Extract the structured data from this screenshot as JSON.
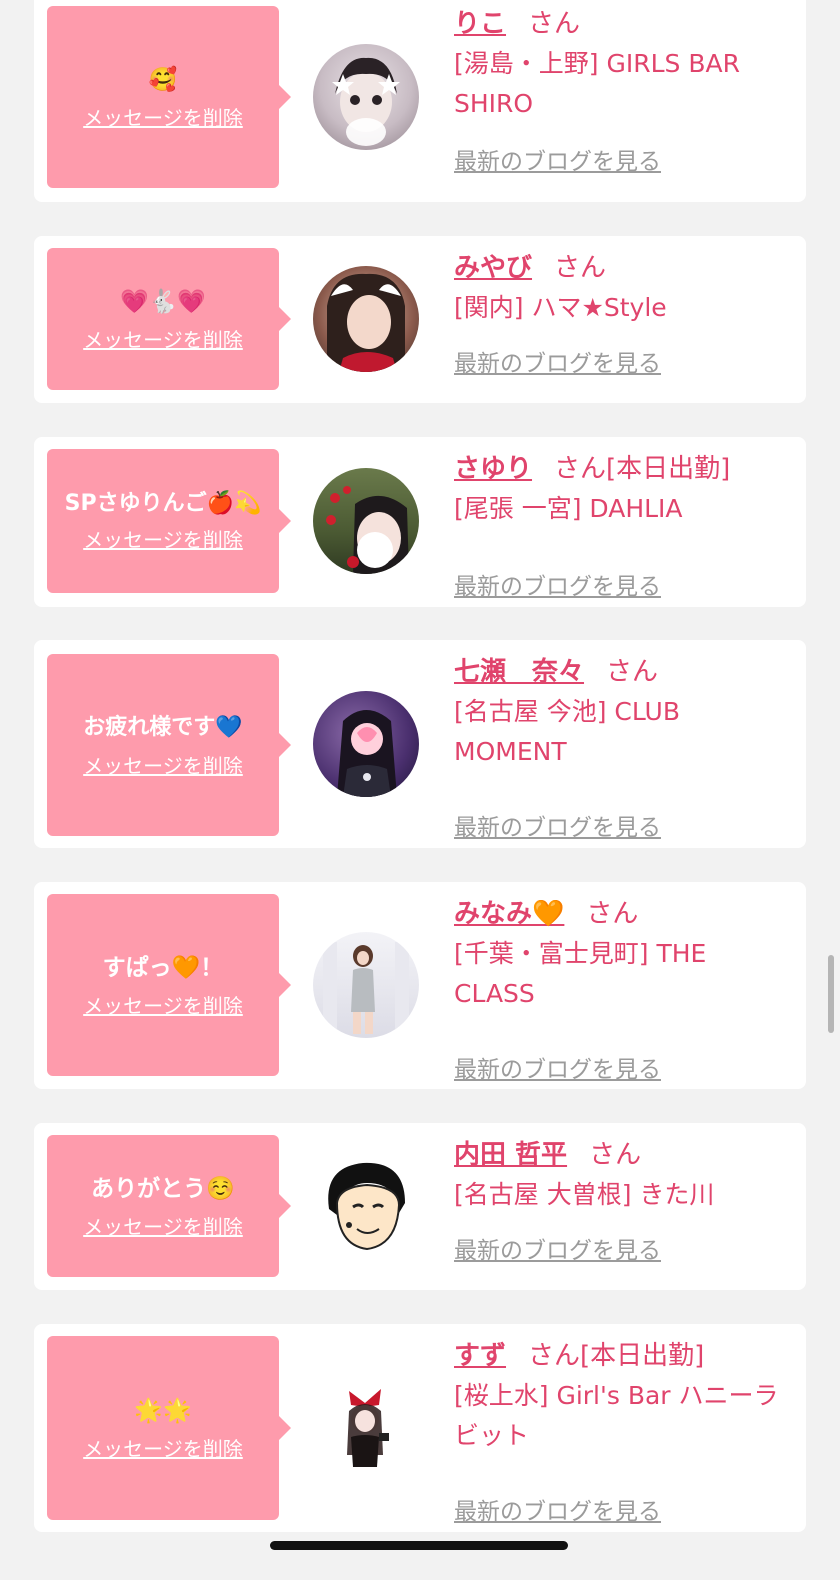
{
  "common": {
    "delete_label": "メッセージを削除",
    "san_label": "さん",
    "blog_label": "最新のブログを見る"
  },
  "colors": {
    "accent_pink": "#fe9bac",
    "name_pink": "#e0446c",
    "link_gray": "#9b9b9b",
    "background": "#f2f2f2"
  },
  "messages": [
    {
      "message": "🥰",
      "name": "りこ",
      "status": "",
      "shop": "[湯島・上野] GIRLS BAR SHIRO"
    },
    {
      "message": "💗🐇💗",
      "name": "みやび",
      "status": "",
      "shop": "[関内] ハマ★Style"
    },
    {
      "message": "SPさゆりんご🍎💫",
      "name": "さゆり",
      "status": "[本日出勤]",
      "shop": "[尾張 一宮] DAHLIA"
    },
    {
      "message": "お疲れ様です💙",
      "name": "七瀬　奈々",
      "status": "",
      "shop": "[名古屋 今池] CLUB MOMENT"
    },
    {
      "message": "すぱっ🧡！",
      "name": "みなみ🧡",
      "status": "",
      "shop": "[千葉・富士見町] THE CLASS"
    },
    {
      "message": "ありがとう☺️",
      "name": "内田 哲平",
      "status": "",
      "shop": "[名古屋 大曽根] きた川"
    },
    {
      "message": "🌟🌟",
      "name": "すず",
      "status": "[本日出勤]",
      "shop": "[桜上水] Girl's Bar ハニーラビット"
    }
  ]
}
